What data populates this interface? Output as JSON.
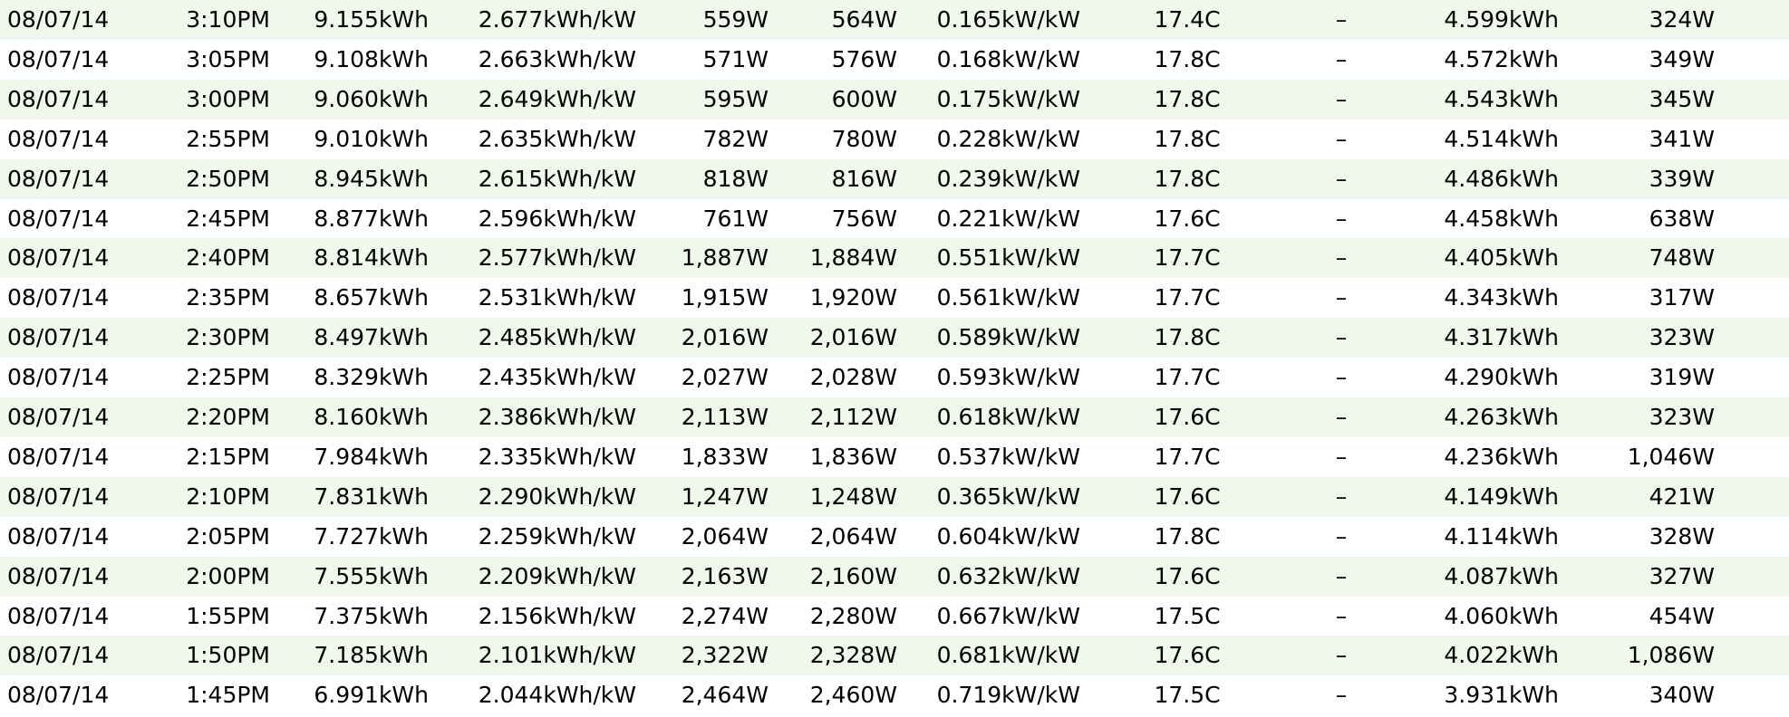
{
  "colors": {
    "row_alt_background": "#eff8ea",
    "row_background": "#ffffff",
    "text": "#000000"
  },
  "rows": [
    {
      "date": "08/07/14",
      "time": "3:10PM",
      "energy": "9.155kWh",
      "efficiency": "2.677kWh/kW",
      "power": "559W",
      "avg_power": "564W",
      "normalised": "0.165kW/kW",
      "temperature": "17.4C",
      "voltage": "–",
      "consumption": "4.599kWh",
      "cons_power": "324W"
    },
    {
      "date": "08/07/14",
      "time": "3:05PM",
      "energy": "9.108kWh",
      "efficiency": "2.663kWh/kW",
      "power": "571W",
      "avg_power": "576W",
      "normalised": "0.168kW/kW",
      "temperature": "17.8C",
      "voltage": "–",
      "consumption": "4.572kWh",
      "cons_power": "349W"
    },
    {
      "date": "08/07/14",
      "time": "3:00PM",
      "energy": "9.060kWh",
      "efficiency": "2.649kWh/kW",
      "power": "595W",
      "avg_power": "600W",
      "normalised": "0.175kW/kW",
      "temperature": "17.8C",
      "voltage": "–",
      "consumption": "4.543kWh",
      "cons_power": "345W"
    },
    {
      "date": "08/07/14",
      "time": "2:55PM",
      "energy": "9.010kWh",
      "efficiency": "2.635kWh/kW",
      "power": "782W",
      "avg_power": "780W",
      "normalised": "0.228kW/kW",
      "temperature": "17.8C",
      "voltage": "–",
      "consumption": "4.514kWh",
      "cons_power": "341W"
    },
    {
      "date": "08/07/14",
      "time": "2:50PM",
      "energy": "8.945kWh",
      "efficiency": "2.615kWh/kW",
      "power": "818W",
      "avg_power": "816W",
      "normalised": "0.239kW/kW",
      "temperature": "17.8C",
      "voltage": "–",
      "consumption": "4.486kWh",
      "cons_power": "339W"
    },
    {
      "date": "08/07/14",
      "time": "2:45PM",
      "energy": "8.877kWh",
      "efficiency": "2.596kWh/kW",
      "power": "761W",
      "avg_power": "756W",
      "normalised": "0.221kW/kW",
      "temperature": "17.6C",
      "voltage": "–",
      "consumption": "4.458kWh",
      "cons_power": "638W"
    },
    {
      "date": "08/07/14",
      "time": "2:40PM",
      "energy": "8.814kWh",
      "efficiency": "2.577kWh/kW",
      "power": "1,887W",
      "avg_power": "1,884W",
      "normalised": "0.551kW/kW",
      "temperature": "17.7C",
      "voltage": "–",
      "consumption": "4.405kWh",
      "cons_power": "748W"
    },
    {
      "date": "08/07/14",
      "time": "2:35PM",
      "energy": "8.657kWh",
      "efficiency": "2.531kWh/kW",
      "power": "1,915W",
      "avg_power": "1,920W",
      "normalised": "0.561kW/kW",
      "temperature": "17.7C",
      "voltage": "–",
      "consumption": "4.343kWh",
      "cons_power": "317W"
    },
    {
      "date": "08/07/14",
      "time": "2:30PM",
      "energy": "8.497kWh",
      "efficiency": "2.485kWh/kW",
      "power": "2,016W",
      "avg_power": "2,016W",
      "normalised": "0.589kW/kW",
      "temperature": "17.8C",
      "voltage": "–",
      "consumption": "4.317kWh",
      "cons_power": "323W"
    },
    {
      "date": "08/07/14",
      "time": "2:25PM",
      "energy": "8.329kWh",
      "efficiency": "2.435kWh/kW",
      "power": "2,027W",
      "avg_power": "2,028W",
      "normalised": "0.593kW/kW",
      "temperature": "17.7C",
      "voltage": "–",
      "consumption": "4.290kWh",
      "cons_power": "319W"
    },
    {
      "date": "08/07/14",
      "time": "2:20PM",
      "energy": "8.160kWh",
      "efficiency": "2.386kWh/kW",
      "power": "2,113W",
      "avg_power": "2,112W",
      "normalised": "0.618kW/kW",
      "temperature": "17.6C",
      "voltage": "–",
      "consumption": "4.263kWh",
      "cons_power": "323W"
    },
    {
      "date": "08/07/14",
      "time": "2:15PM",
      "energy": "7.984kWh",
      "efficiency": "2.335kWh/kW",
      "power": "1,833W",
      "avg_power": "1,836W",
      "normalised": "0.537kW/kW",
      "temperature": "17.7C",
      "voltage": "–",
      "consumption": "4.236kWh",
      "cons_power": "1,046W"
    },
    {
      "date": "08/07/14",
      "time": "2:10PM",
      "energy": "7.831kWh",
      "efficiency": "2.290kWh/kW",
      "power": "1,247W",
      "avg_power": "1,248W",
      "normalised": "0.365kW/kW",
      "temperature": "17.6C",
      "voltage": "–",
      "consumption": "4.149kWh",
      "cons_power": "421W"
    },
    {
      "date": "08/07/14",
      "time": "2:05PM",
      "energy": "7.727kWh",
      "efficiency": "2.259kWh/kW",
      "power": "2,064W",
      "avg_power": "2,064W",
      "normalised": "0.604kW/kW",
      "temperature": "17.8C",
      "voltage": "–",
      "consumption": "4.114kWh",
      "cons_power": "328W"
    },
    {
      "date": "08/07/14",
      "time": "2:00PM",
      "energy": "7.555kWh",
      "efficiency": "2.209kWh/kW",
      "power": "2,163W",
      "avg_power": "2,160W",
      "normalised": "0.632kW/kW",
      "temperature": "17.6C",
      "voltage": "–",
      "consumption": "4.087kWh",
      "cons_power": "327W"
    },
    {
      "date": "08/07/14",
      "time": "1:55PM",
      "energy": "7.375kWh",
      "efficiency": "2.156kWh/kW",
      "power": "2,274W",
      "avg_power": "2,280W",
      "normalised": "0.667kW/kW",
      "temperature": "17.5C",
      "voltage": "–",
      "consumption": "4.060kWh",
      "cons_power": "454W"
    },
    {
      "date": "08/07/14",
      "time": "1:50PM",
      "energy": "7.185kWh",
      "efficiency": "2.101kWh/kW",
      "power": "2,322W",
      "avg_power": "2,328W",
      "normalised": "0.681kW/kW",
      "temperature": "17.6C",
      "voltage": "–",
      "consumption": "4.022kWh",
      "cons_power": "1,086W"
    },
    {
      "date": "08/07/14",
      "time": "1:45PM",
      "energy": "6.991kWh",
      "efficiency": "2.044kWh/kW",
      "power": "2,464W",
      "avg_power": "2,460W",
      "normalised": "0.719kW/kW",
      "temperature": "17.5C",
      "voltage": "–",
      "consumption": "3.931kWh",
      "cons_power": "340W"
    }
  ]
}
